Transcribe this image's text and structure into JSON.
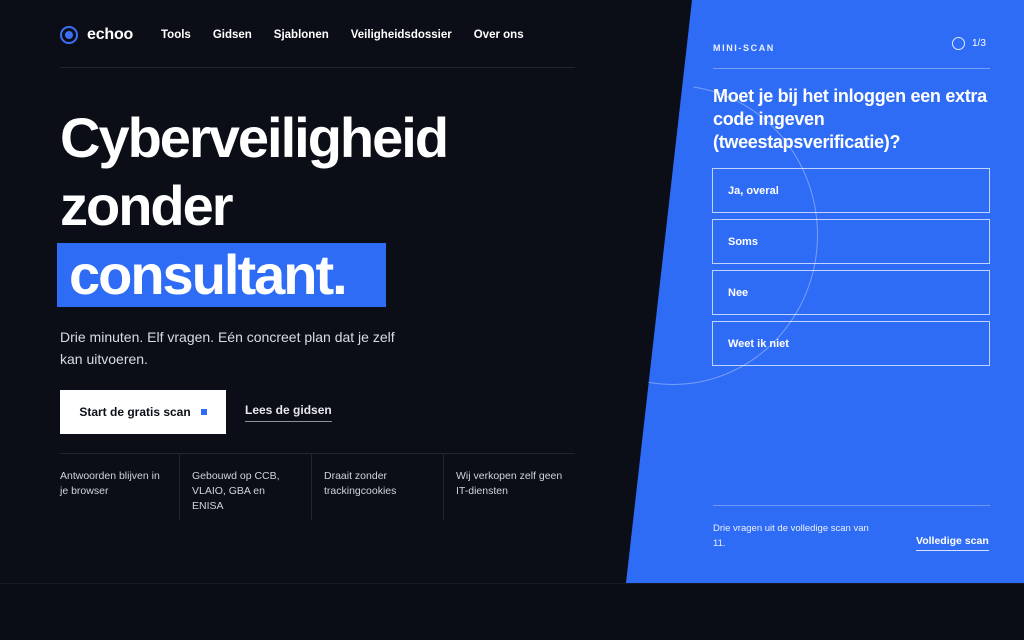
{
  "brand": {
    "name": "echoo",
    "accent": "#2f6cf6",
    "background": "#0b0e16"
  },
  "nav": {
    "items": [
      "Tools",
      "Gidsen",
      "Sjablonen",
      "Veiligheidsdossier",
      "Over ons"
    ]
  },
  "hero": {
    "line1": "Cyberveiligheid",
    "line2": "zonder",
    "highlight": "consultant.",
    "subtitle": "Drie minuten. Elf vragen. Eén concreet plan dat je zelf kan uitvoeren.",
    "cta_primary": "Start de gratis scan",
    "cta_secondary": "Lees de gidsen"
  },
  "features": [
    "Antwoorden blijven in je browser",
    "Gebouwd op CCB, VLAIO, GBA en ENISA",
    "Draait zonder trackingcookies",
    "Wij verkopen zelf geen IT-diensten"
  ],
  "mini_scan": {
    "label": "MINI-SCAN",
    "progress": "1/3",
    "question": "Moet je bij het inloggen een extra code ingeven (tweestapsverificatie)?",
    "options": [
      "Ja, overal",
      "Soms",
      "Nee",
      "Weet ik niet"
    ],
    "note": "Drie vragen uit de volledige scan van 11.",
    "link": "Volledige scan"
  }
}
